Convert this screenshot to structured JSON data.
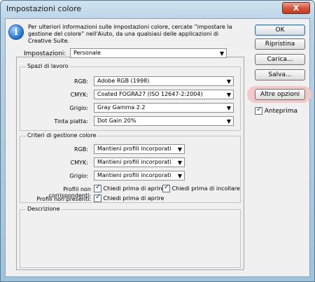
{
  "window": {
    "title": "Impostazioni colore",
    "close_glyph": "X"
  },
  "info": {
    "icon": "info-icon",
    "text": "Per ulteriori informazioni sulle impostazioni colore, cercate “impostare la gestione del colore” nell'Aiuto, da una qualsiasi delle applicazioni di Creative Suite."
  },
  "buttons": {
    "ok": "OK",
    "ripristina": "Ripristina",
    "carica": "Carica...",
    "salva": "Salva...",
    "altre_opzioni": "Altre opzioni",
    "anteprima": "Anteprima"
  },
  "impostazioni": {
    "label": "Impostazioni:",
    "value": "Personale"
  },
  "spazi": {
    "title": "Spazi di lavoro",
    "rows": [
      {
        "label": "RGB:",
        "value": "Adobe RGB (1998)"
      },
      {
        "label": "CMYK:",
        "value": "Coated FOGRA27 (ISO 12647-2:2004)"
      },
      {
        "label": "Grigio:",
        "value": "Gray Gamma 2.2"
      },
      {
        "label": "Tinta piatta:",
        "value": "Dot Gain 20%"
      }
    ]
  },
  "criteri": {
    "title": "Criteri di gestione colore",
    "rows": [
      {
        "label": "RGB:",
        "value": "Mantieni profili incorporati"
      },
      {
        "label": "CMYK:",
        "value": "Mantieni profili incorporati"
      },
      {
        "label": "Grigio:",
        "value": "Mantieni profili incorporati"
      }
    ],
    "non_corrispondenti": "Profili non corrispondenti:",
    "chiedi_aprire": "Chiedi prima di aprire",
    "chiedi_incollare": "Chiedi prima di incollare",
    "non_presenti": "Profili non presenti:",
    "chiedi_aprire2": "Chiedi prima di aprire"
  },
  "descrizione": {
    "title": "Descrizione"
  }
}
